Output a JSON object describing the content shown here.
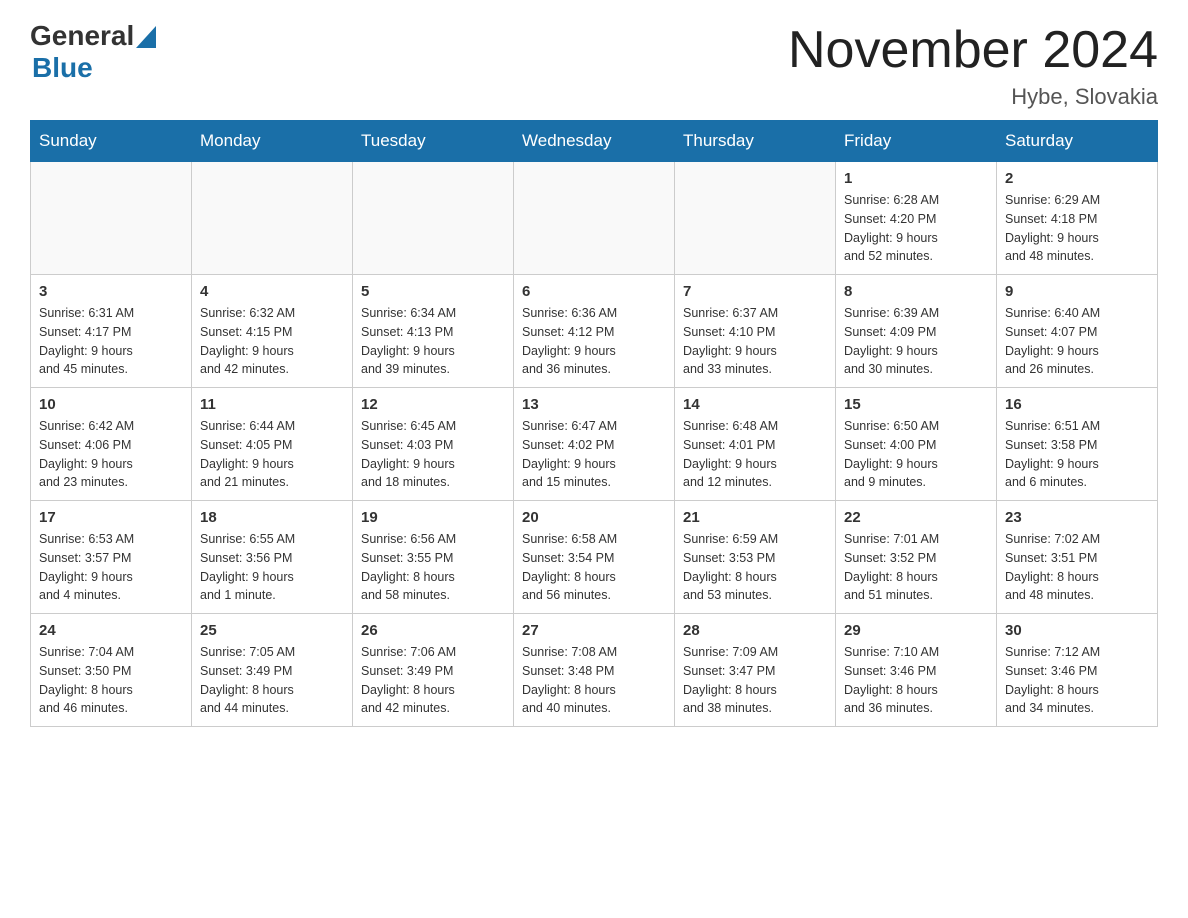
{
  "header": {
    "logo_general": "General",
    "logo_blue": "Blue",
    "title": "November 2024",
    "subtitle": "Hybe, Slovakia"
  },
  "weekdays": [
    "Sunday",
    "Monday",
    "Tuesday",
    "Wednesday",
    "Thursday",
    "Friday",
    "Saturday"
  ],
  "weeks": [
    [
      {
        "day": "",
        "info": ""
      },
      {
        "day": "",
        "info": ""
      },
      {
        "day": "",
        "info": ""
      },
      {
        "day": "",
        "info": ""
      },
      {
        "day": "",
        "info": ""
      },
      {
        "day": "1",
        "info": "Sunrise: 6:28 AM\nSunset: 4:20 PM\nDaylight: 9 hours\nand 52 minutes."
      },
      {
        "day": "2",
        "info": "Sunrise: 6:29 AM\nSunset: 4:18 PM\nDaylight: 9 hours\nand 48 minutes."
      }
    ],
    [
      {
        "day": "3",
        "info": "Sunrise: 6:31 AM\nSunset: 4:17 PM\nDaylight: 9 hours\nand 45 minutes."
      },
      {
        "day": "4",
        "info": "Sunrise: 6:32 AM\nSunset: 4:15 PM\nDaylight: 9 hours\nand 42 minutes."
      },
      {
        "day": "5",
        "info": "Sunrise: 6:34 AM\nSunset: 4:13 PM\nDaylight: 9 hours\nand 39 minutes."
      },
      {
        "day": "6",
        "info": "Sunrise: 6:36 AM\nSunset: 4:12 PM\nDaylight: 9 hours\nand 36 minutes."
      },
      {
        "day": "7",
        "info": "Sunrise: 6:37 AM\nSunset: 4:10 PM\nDaylight: 9 hours\nand 33 minutes."
      },
      {
        "day": "8",
        "info": "Sunrise: 6:39 AM\nSunset: 4:09 PM\nDaylight: 9 hours\nand 30 minutes."
      },
      {
        "day": "9",
        "info": "Sunrise: 6:40 AM\nSunset: 4:07 PM\nDaylight: 9 hours\nand 26 minutes."
      }
    ],
    [
      {
        "day": "10",
        "info": "Sunrise: 6:42 AM\nSunset: 4:06 PM\nDaylight: 9 hours\nand 23 minutes."
      },
      {
        "day": "11",
        "info": "Sunrise: 6:44 AM\nSunset: 4:05 PM\nDaylight: 9 hours\nand 21 minutes."
      },
      {
        "day": "12",
        "info": "Sunrise: 6:45 AM\nSunset: 4:03 PM\nDaylight: 9 hours\nand 18 minutes."
      },
      {
        "day": "13",
        "info": "Sunrise: 6:47 AM\nSunset: 4:02 PM\nDaylight: 9 hours\nand 15 minutes."
      },
      {
        "day": "14",
        "info": "Sunrise: 6:48 AM\nSunset: 4:01 PM\nDaylight: 9 hours\nand 12 minutes."
      },
      {
        "day": "15",
        "info": "Sunrise: 6:50 AM\nSunset: 4:00 PM\nDaylight: 9 hours\nand 9 minutes."
      },
      {
        "day": "16",
        "info": "Sunrise: 6:51 AM\nSunset: 3:58 PM\nDaylight: 9 hours\nand 6 minutes."
      }
    ],
    [
      {
        "day": "17",
        "info": "Sunrise: 6:53 AM\nSunset: 3:57 PM\nDaylight: 9 hours\nand 4 minutes."
      },
      {
        "day": "18",
        "info": "Sunrise: 6:55 AM\nSunset: 3:56 PM\nDaylight: 9 hours\nand 1 minute."
      },
      {
        "day": "19",
        "info": "Sunrise: 6:56 AM\nSunset: 3:55 PM\nDaylight: 8 hours\nand 58 minutes."
      },
      {
        "day": "20",
        "info": "Sunrise: 6:58 AM\nSunset: 3:54 PM\nDaylight: 8 hours\nand 56 minutes."
      },
      {
        "day": "21",
        "info": "Sunrise: 6:59 AM\nSunset: 3:53 PM\nDaylight: 8 hours\nand 53 minutes."
      },
      {
        "day": "22",
        "info": "Sunrise: 7:01 AM\nSunset: 3:52 PM\nDaylight: 8 hours\nand 51 minutes."
      },
      {
        "day": "23",
        "info": "Sunrise: 7:02 AM\nSunset: 3:51 PM\nDaylight: 8 hours\nand 48 minutes."
      }
    ],
    [
      {
        "day": "24",
        "info": "Sunrise: 7:04 AM\nSunset: 3:50 PM\nDaylight: 8 hours\nand 46 minutes."
      },
      {
        "day": "25",
        "info": "Sunrise: 7:05 AM\nSunset: 3:49 PM\nDaylight: 8 hours\nand 44 minutes."
      },
      {
        "day": "26",
        "info": "Sunrise: 7:06 AM\nSunset: 3:49 PM\nDaylight: 8 hours\nand 42 minutes."
      },
      {
        "day": "27",
        "info": "Sunrise: 7:08 AM\nSunset: 3:48 PM\nDaylight: 8 hours\nand 40 minutes."
      },
      {
        "day": "28",
        "info": "Sunrise: 7:09 AM\nSunset: 3:47 PM\nDaylight: 8 hours\nand 38 minutes."
      },
      {
        "day": "29",
        "info": "Sunrise: 7:10 AM\nSunset: 3:46 PM\nDaylight: 8 hours\nand 36 minutes."
      },
      {
        "day": "30",
        "info": "Sunrise: 7:12 AM\nSunset: 3:46 PM\nDaylight: 8 hours\nand 34 minutes."
      }
    ]
  ]
}
